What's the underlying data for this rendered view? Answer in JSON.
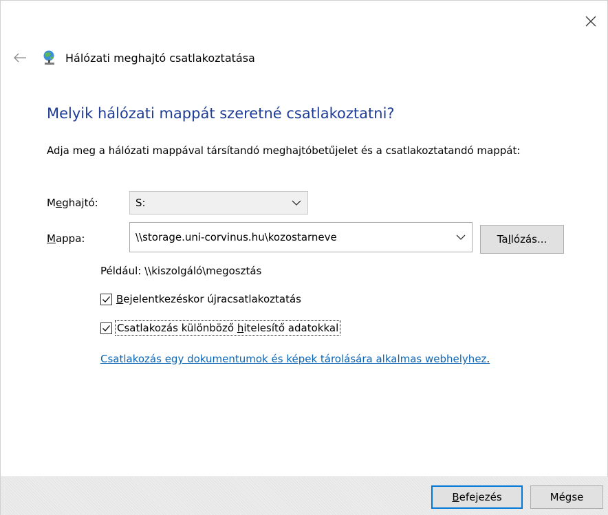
{
  "header": {
    "window_title": "Hálózati meghajtó csatlakoztatása",
    "back_icon": "back-arrow-icon",
    "app_icon": "network-drive-icon",
    "close_icon": "close-icon"
  },
  "main": {
    "heading": "Melyik hálózati mappát szeretné csatlakoztatni?",
    "instructions": "Adja meg a hálózati mappával társítandó meghajtóbetűjelet és a csatlakoztatandó mappát:",
    "drive": {
      "label_pre": "M",
      "label_u": "e",
      "label_post": "ghajtó:",
      "value": "S:"
    },
    "folder": {
      "label_pre": "",
      "label_u": "M",
      "label_post": "appa:",
      "value": "\\\\storage.uni-corvinus.hu\\kozostarneve"
    },
    "browse": {
      "label_pre": "Ta",
      "label_u": "l",
      "label_post": "lózás..."
    },
    "example": "Például: \\\\kiszolgáló\\megosztás",
    "reconnect": {
      "checked": true,
      "label_u": "B",
      "label_post": "ejelentkezéskor újracsatlakoztatás"
    },
    "credentials": {
      "checked": true,
      "label_pre": "Csatlakozás különböző ",
      "label_u": "h",
      "label_post": "itelesítő adatokkal"
    },
    "link": {
      "text": "Csatlakozás egy dokumentumok és képek tárolására alkalmas webhelyhez",
      "suffix": "."
    }
  },
  "footer": {
    "finish": {
      "label_u": "B",
      "label_post": "efejezés"
    },
    "cancel": {
      "label": "Mégse"
    }
  },
  "colors": {
    "heading": "#1e3c96",
    "link": "#0a64b4",
    "focus": "#0078d7"
  }
}
